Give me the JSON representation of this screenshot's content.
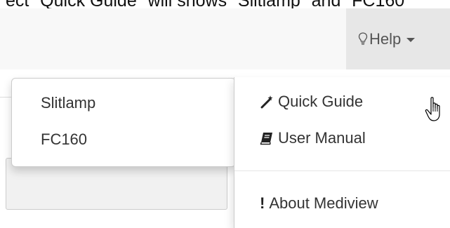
{
  "caption": "ect \"Quick Guide\" will shows \"Slitlamp\" and \"FC160\"",
  "navbar": {
    "help_label": "Help",
    "help_icon": "lightbulb-icon",
    "caret_icon": "caret-down-icon"
  },
  "quick_guide_submenu": {
    "items": [
      "Slitlamp",
      "FC160"
    ]
  },
  "help_menu": {
    "quick_guide": {
      "label": "Quick Guide",
      "icon": "magic-wand-icon"
    },
    "user_manual": {
      "label": "User Manual",
      "icon": "book-icon"
    },
    "about": {
      "label": "About Mediview",
      "icon": "exclamation-icon",
      "glyph": "!"
    }
  },
  "cursor_icon": "hand-pointer-icon"
}
